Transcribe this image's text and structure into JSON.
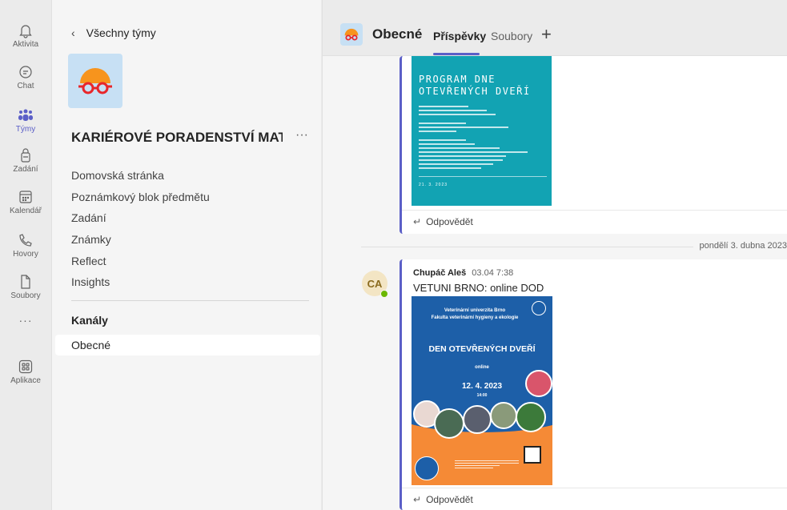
{
  "rail": {
    "items": [
      {
        "label": "Aktivita",
        "icon": "bell-icon"
      },
      {
        "label": "Chat",
        "icon": "chat-icon"
      },
      {
        "label": "Týmy",
        "icon": "teams-icon"
      },
      {
        "label": "Zadání",
        "icon": "assignments-icon"
      },
      {
        "label": "Kalendář",
        "icon": "calendar-icon"
      },
      {
        "label": "Hovory",
        "icon": "phone-icon"
      },
      {
        "label": "Soubory",
        "icon": "file-icon"
      },
      {
        "label": "Aplikace",
        "icon": "apps-icon"
      }
    ],
    "more": "···",
    "active_color": "#5b5fc7"
  },
  "team_panel": {
    "back_label": "Všechny týmy",
    "team_name": "KARIÉROVÉ PORADENSTVÍ MAT...",
    "more": "···",
    "nav": [
      "Domovská stránka",
      "Poznámkový blok předmětu",
      "Zadání",
      "Známky",
      "Reflect",
      "Insights"
    ],
    "channels_heading": "Kanály",
    "channels": [
      "Obecné"
    ]
  },
  "header": {
    "channel": "Obecné",
    "tabs": [
      "Příspěvky",
      "Soubory"
    ],
    "active_tab": "Příspěvky",
    "add_tab": "+"
  },
  "posts": [
    {
      "poster": {
        "title_line1": "PROGRAM DNE",
        "title_line2": "OTEVŘENÝCH DVEŘÍ",
        "date": "21. 3. 2023"
      },
      "reply": "Odpovědět"
    },
    {
      "author_initials": "CA",
      "author": "Chupáč Aleš",
      "time": "03.04 7:38",
      "text": "VETUNI BRNO: online DOD",
      "poster": {
        "university": "Veterinární univerzita Brno",
        "faculty": "Fakulta veterinární hygieny a ekologie",
        "title": "DEN OTEVŘENÝCH DVEŘÍ",
        "mode": "online",
        "date": "12. 4. 2023",
        "time": "14:00"
      },
      "reply": "Odpovědět"
    }
  ],
  "date_separator": "pondělí 3. dubna 2023"
}
